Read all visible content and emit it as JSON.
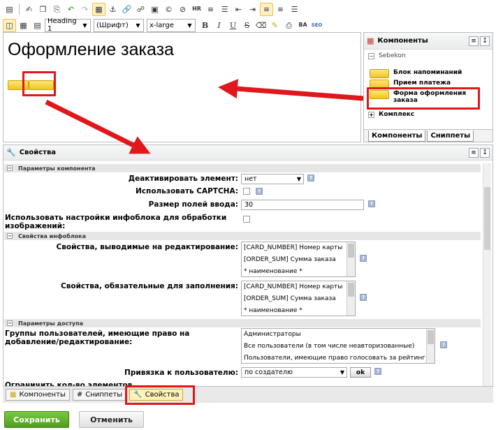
{
  "toolbar": {
    "row1_icons": [
      "source-icon",
      "new-page-icon",
      "copy-icon",
      "paste-icon",
      "undo-icon",
      "redo-icon",
      "table-icon",
      "anchor-icon",
      "link-icon",
      "unlink-icon",
      "image-icon",
      "special-char-icon",
      "flash-icon",
      "hr-icon",
      "ordered-list-icon",
      "unordered-list-icon",
      "outdent-icon",
      "indent-icon",
      "align-left-icon",
      "align-center-icon",
      "align-justify-icon"
    ],
    "hr_label": "HR",
    "format_value": "Heading 1",
    "font_value": "(Шрифт)",
    "size_value": "x-large",
    "bold_label": "B",
    "italic_label": "I",
    "underline_label": "U",
    "strike_label": "S",
    "spell_label": "BA",
    "seo_label": "SEO"
  },
  "editor": {
    "title": "Оформление заказа"
  },
  "components_panel": {
    "title": "Компоненты",
    "group": "Sebekon",
    "items": [
      "Блок напоминаний",
      "Прием платежа",
      "Форма оформления заказа"
    ],
    "collapsed_item": "Комплекс",
    "tabs": [
      "Компоненты",
      "Сниппеты"
    ]
  },
  "properties": {
    "title": "Свойства",
    "sections": [
      "Параметры компонента",
      "Свойства инфоблока",
      "Параметры доступа"
    ],
    "deactivate": {
      "label": "Деактивировать элемент:",
      "value": "нет"
    },
    "captcha": {
      "label": "Использовать CAPTCHA:"
    },
    "input_size": {
      "label": "Размер полей ввода:",
      "value": "30"
    },
    "iblock_settings": {
      "label": "Использовать настройки инфоблока для обработки изображений:"
    },
    "editable_props": {
      "label": "Свойства, выводимые на редактирование:",
      "options": [
        "[CARD_NUMBER] Номер карты",
        "[ORDER_SUM] Сумма заказа",
        "* наименование *"
      ]
    },
    "required_props": {
      "label": "Свойства, обязательные для заполнения:",
      "options": [
        "[CARD_NUMBER] Номер карты",
        "[ORDER_SUM] Сумма заказа",
        "* наименование *"
      ]
    },
    "groups": {
      "label": "Группы пользователей, имеющие право на добавление/редактирование:",
      "options": [
        "Администраторы",
        "Все пользователи (в том числе неавторизованные)",
        "Пользователи, имеющие право голосовать за рейтинг"
      ]
    },
    "bind_user": {
      "label": "Привязка к пользователю:",
      "value": "по создателю",
      "ok_label": "ok"
    },
    "cut_label": "Ограничить кол-во элементов"
  },
  "tabbar": {
    "tabs": [
      "Компоненты",
      "Сниппеты",
      "Свойства"
    ]
  },
  "actions": {
    "save_label": "Сохранить",
    "cancel_label": "Отменить"
  },
  "colors": {
    "highlight": "#e0171b",
    "save_button": "#5aa928",
    "selected_tab": "#fff3b8"
  }
}
